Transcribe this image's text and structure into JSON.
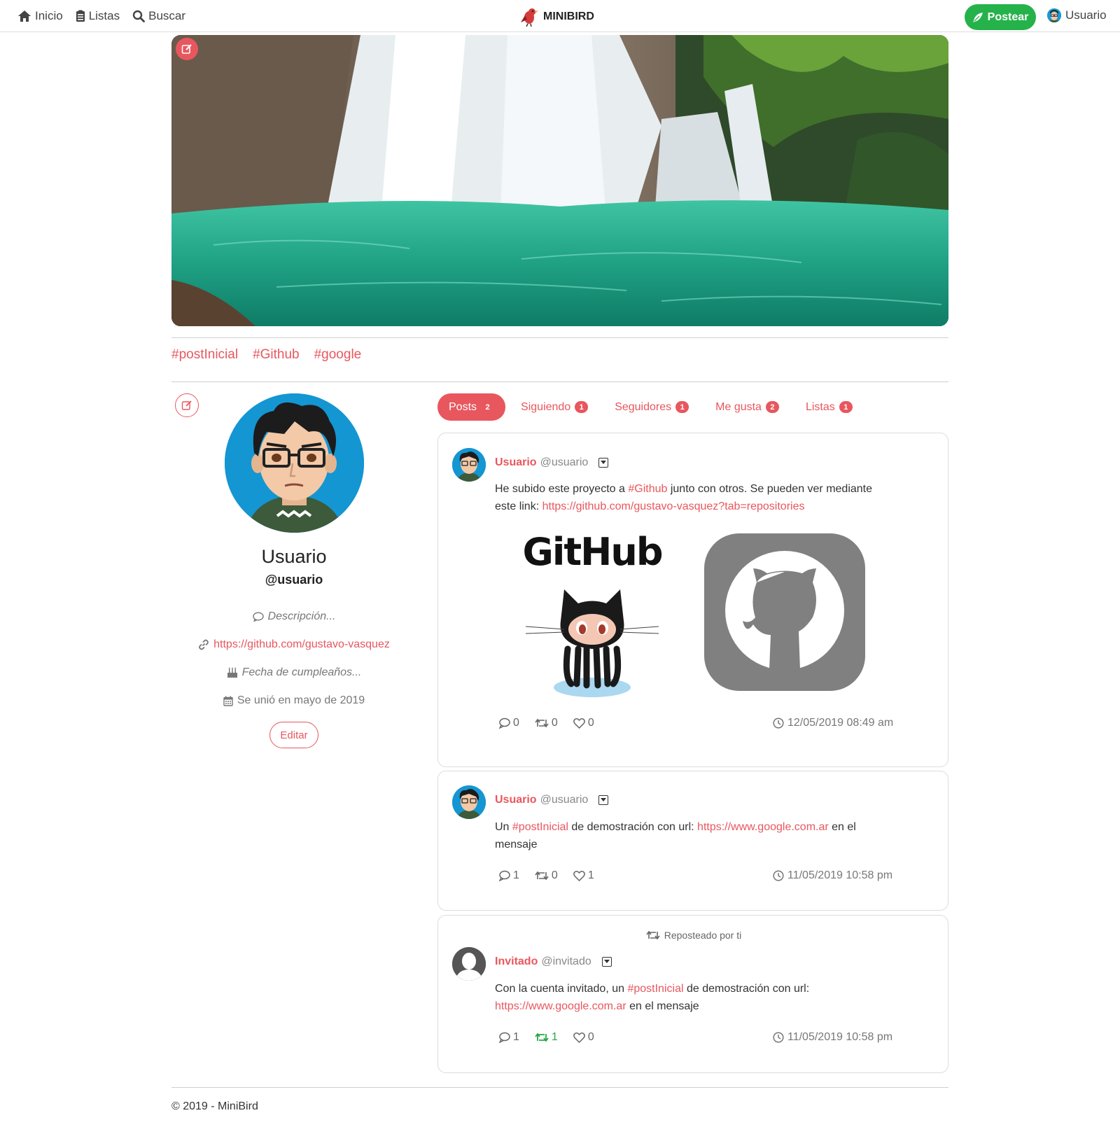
{
  "nav": {
    "home": "Inicio",
    "lists": "Listas",
    "search": "Buscar",
    "brand": "MINIBIRD",
    "post_button": "Postear",
    "user": "Usuario",
    "accent_color": "#e8575e",
    "post_button_color": "#26b24b"
  },
  "hashtags": [
    "#postInicial",
    "#Github",
    "#google"
  ],
  "profile": {
    "name": "Usuario",
    "handle": "@usuario",
    "description": "Descripción...",
    "url": "https://github.com/gustavo-vasquez",
    "birthday": "Fecha de cumpleaños...",
    "joined": "Se unió en mayo de 2019",
    "edit_button": "Editar"
  },
  "tabs": [
    {
      "label": "Posts",
      "count": "2"
    },
    {
      "label": "Siguiendo",
      "count": "1"
    },
    {
      "label": "Seguidores",
      "count": "1"
    },
    {
      "label": "Me gusta",
      "count": "2"
    },
    {
      "label": "Listas",
      "count": "1"
    }
  ],
  "posts": [
    {
      "author": "Usuario",
      "handle": "@usuario",
      "text_parts": [
        "He subido este proyecto a ",
        "#Github",
        " junto con otros. Se pueden ver mediante este link: ",
        "https://github.com/gustavo-vasquez?tab=repositories"
      ],
      "image_text": "GitHub",
      "replies": "0",
      "reposts": "0",
      "likes": "0",
      "time": "12/05/2019 08:49 am"
    },
    {
      "author": "Usuario",
      "handle": "@usuario",
      "text_parts": [
        "Un ",
        "#postInicial",
        " de demostración con url: ",
        "https://www.google.com.ar",
        " en el mensaje"
      ],
      "replies": "1",
      "reposts": "0",
      "likes": "1",
      "time": "11/05/2019 10:58 pm"
    },
    {
      "repost_note": "Reposteado por ti",
      "author": "Invitado",
      "handle": "@invitado",
      "text_parts": [
        "Con la cuenta invitado, un ",
        "#postInicial",
        " de demostración con url: ",
        "https://www.google.com.ar",
        " en el mensaje"
      ],
      "replies": "1",
      "reposts": "1",
      "likes": "0",
      "time": "11/05/2019 10:58 pm"
    }
  ],
  "footer": "© 2019 - MiniBird"
}
